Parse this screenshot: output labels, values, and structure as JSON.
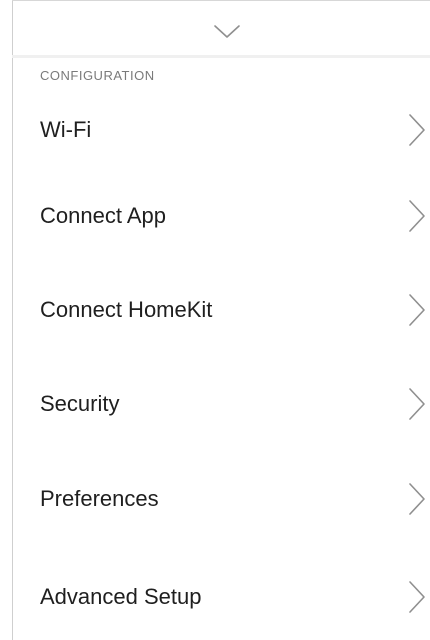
{
  "header": {
    "collapse_icon": "chevron-down-icon"
  },
  "section": {
    "title": "CONFIGURATION"
  },
  "menu": {
    "chevron_icon": "chevron-right-icon",
    "items": [
      {
        "label": "Wi-Fi"
      },
      {
        "label": "Connect App"
      },
      {
        "label": "Connect HomeKit"
      },
      {
        "label": "Security"
      },
      {
        "label": "Preferences"
      },
      {
        "label": "Advanced Setup"
      }
    ]
  },
  "colors": {
    "background": "#ffffff",
    "text": "#1f1f1f",
    "section_label": "#7a7a7a",
    "chevron": "#8f8f8f",
    "divider": "#f0f0f0"
  }
}
